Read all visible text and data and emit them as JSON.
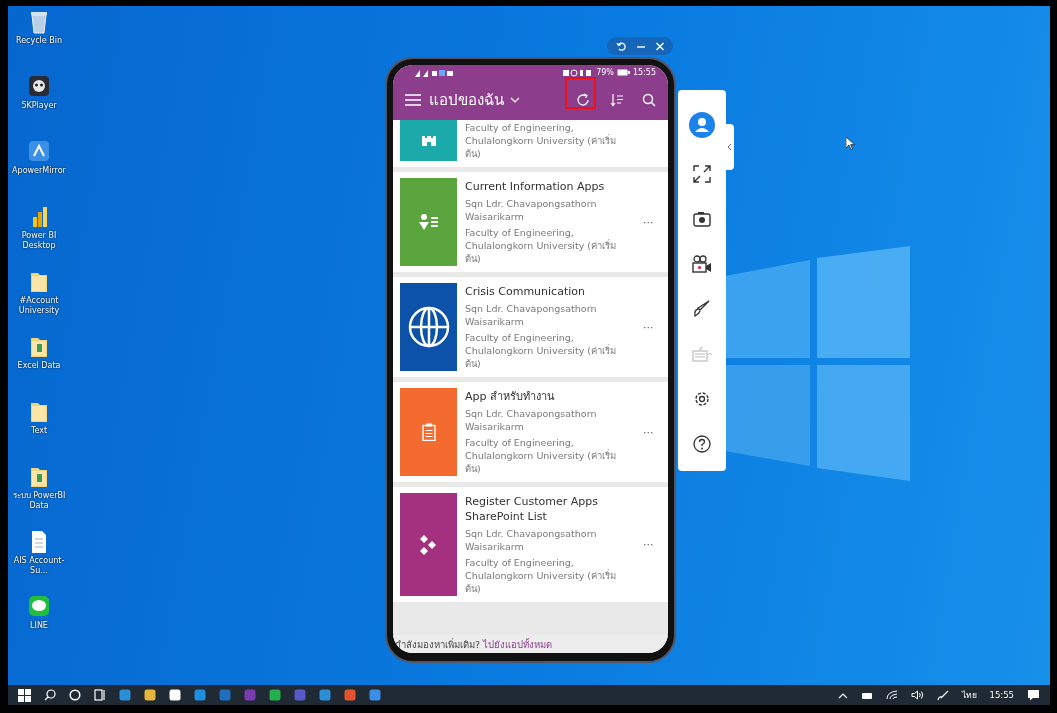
{
  "desktop_icons": [
    {
      "label": "Recycle Bin",
      "kind": "recycle"
    },
    {
      "label": "5KPlayer",
      "kind": "player"
    },
    {
      "label": "ApowerMirror",
      "kind": "mirror"
    },
    {
      "label": "Power BI Desktop",
      "kind": "powerbi"
    },
    {
      "label": "#Account University",
      "kind": "folder"
    },
    {
      "label": "Excel Data",
      "kind": "folder-file"
    },
    {
      "label": "Text",
      "kind": "folder"
    },
    {
      "label": "ระบบ PowerBI Data",
      "kind": "folder-file"
    },
    {
      "label": "AIS Account-Su...",
      "kind": "document"
    },
    {
      "label": "LINE",
      "kind": "line"
    }
  ],
  "phone": {
    "status_bar": {
      "battery": "79%",
      "time": "15:55"
    },
    "header": {
      "title": "แอปของฉัน"
    },
    "apps": [
      {
        "kind": "building",
        "color": "#1ba9aa",
        "organization": "Faculty of Engineering, Chulalongkorn University (ค่าเริ่มต้น)"
      },
      {
        "kind": "person-list",
        "color": "#5aa53d",
        "title": "Current Information Apps",
        "owner": "Sqn Ldr. Chavapongsathorn Waisarikarm",
        "organization": "Faculty of Engineering, Chulalongkorn University (ค่าเริ่มต้น)",
        "more": "···"
      },
      {
        "kind": "globe",
        "color": "#0c52a8",
        "title": "Crisis Communication",
        "owner": "Sqn Ldr. Chavapongsathorn Waisarikarm",
        "organization": "Faculty of Engineering, Chulalongkorn University (ค่าเริ่มต้น)",
        "more": "···"
      },
      {
        "kind": "clipboard",
        "color": "#f36b2f",
        "title": "App สำหรับทำงาน",
        "owner": "Sqn Ldr. Chavapongsathorn Waisarikarm",
        "organization": "Faculty of Engineering, Chulalongkorn University (ค่าเริ่มต้น)",
        "more": "···"
      },
      {
        "kind": "diamonds",
        "color": "#a4317f",
        "title": "Register Customer Apps SharePoint List",
        "owner": "Sqn Ldr. Chavapongsathorn Waisarikarm",
        "organization": "Faculty of Engineering, Chulalongkorn University (ค่าเริ่มต้น)",
        "more": "···"
      }
    ],
    "footer": {
      "prompt": "กำลังมองหาเพิ่มเติม?",
      "link": "ไปยังแอปทั้งหมด"
    }
  },
  "taskbar": {
    "language": "ไทย",
    "time": "15:55"
  }
}
